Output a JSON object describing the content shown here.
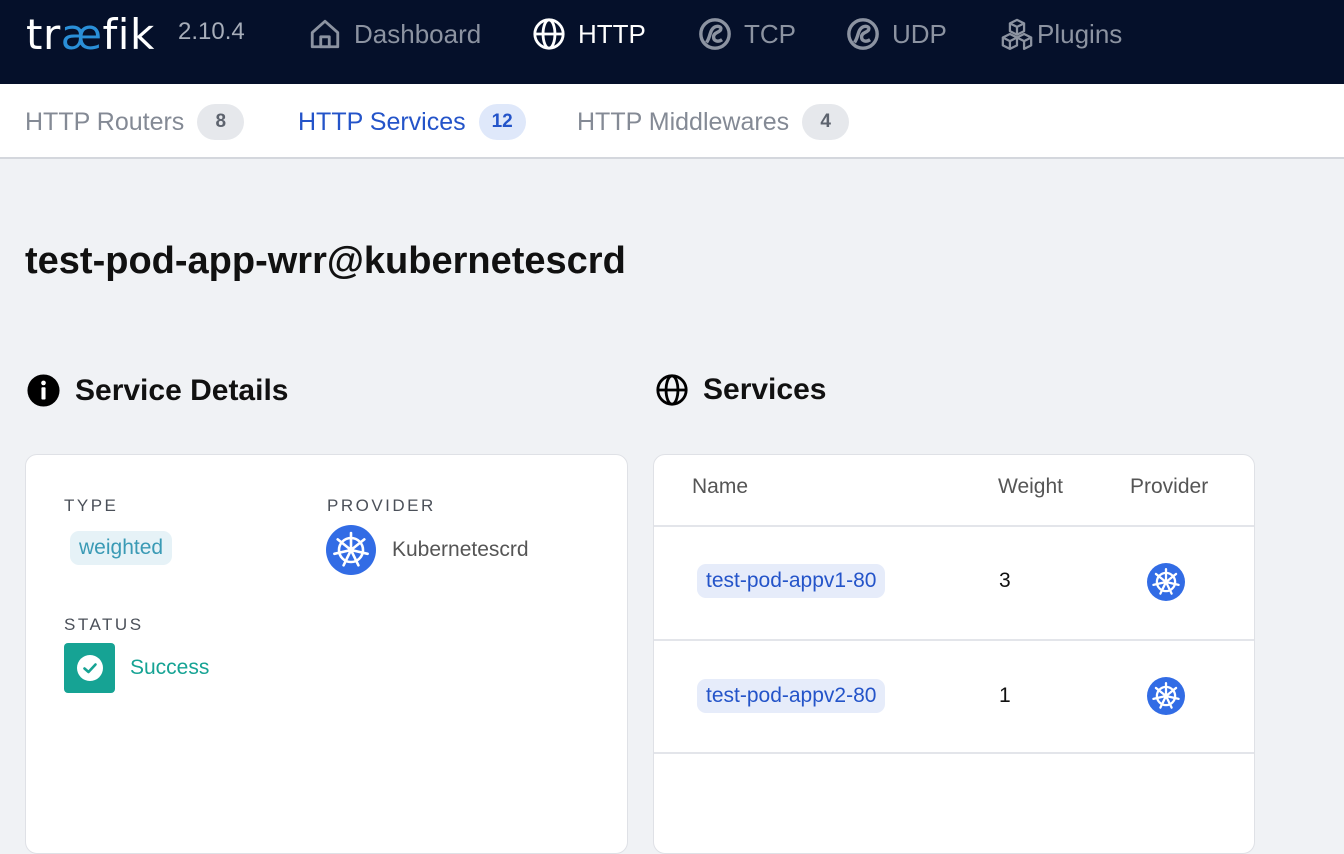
{
  "app": {
    "logo_pre": "tr",
    "logo_ae": "æ",
    "logo_post": "fik",
    "version": "2.10.4"
  },
  "nav": {
    "dashboard": "Dashboard",
    "http": "HTTP",
    "tcp": "TCP",
    "udp": "UDP",
    "plugins": "Plugins"
  },
  "tabs": {
    "routers": {
      "label": "HTTP Routers",
      "count": "8"
    },
    "services": {
      "label": "HTTP Services",
      "count": "12"
    },
    "middlewares": {
      "label": "HTTP Middlewares",
      "count": "4"
    }
  },
  "page_title": "test-pod-app-wrr@kubernetescrd",
  "details": {
    "title": "Service Details",
    "type_label": "TYPE",
    "type_value": "weighted",
    "provider_label": "PROVIDER",
    "provider_value": "Kubernetescrd",
    "status_label": "STATUS",
    "status_value": "Success"
  },
  "services": {
    "title": "Services",
    "headers": {
      "name": "Name",
      "weight": "Weight",
      "provider": "Provider"
    },
    "rows": [
      {
        "name": "test-pod-appv1-80",
        "weight": "3",
        "provider_icon": "kubernetes-icon"
      },
      {
        "name": "test-pod-appv2-80",
        "weight": "1",
        "provider_icon": "kubernetes-icon"
      }
    ]
  },
  "colors": {
    "nav_bg": "#05102a",
    "accent_blue": "#2454c9",
    "success_green": "#16a394",
    "type_chip_text": "#3a9ab5",
    "kubernetes_blue": "#326ce5"
  }
}
